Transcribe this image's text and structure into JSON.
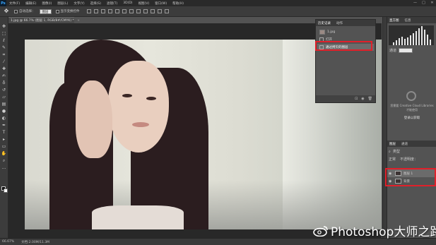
{
  "menubar": {
    "logo": "Ps",
    "items": [
      "文件(F)",
      "编辑(E)",
      "图像(I)",
      "图层(L)",
      "文字(Y)",
      "选择(S)",
      "滤镜(T)",
      "3D(D)",
      "视图(V)",
      "窗口(W)",
      "帮助(H)"
    ],
    "window_controls": [
      "—",
      "□",
      "✕"
    ]
  },
  "options": {
    "auto_select_label": "自动选择：",
    "auto_select_value": "图层",
    "show_transform_label": "显示变换控件"
  },
  "document": {
    "tab_title": "1.jpg @ 66.7% (图层 1, RGB/8#/CMYK) *",
    "close": "×"
  },
  "history_panel": {
    "tabs": [
      "历史记录",
      "动作"
    ],
    "snapshot_label": "1.jpg",
    "rows": [
      "打开",
      "通过拷贝的图层"
    ],
    "footer_icons": [
      "snapshot-icon",
      "camera-icon",
      "trash-icon"
    ]
  },
  "histogram_panel": {
    "tabs": [
      "直方图",
      "信息"
    ],
    "channel": "通道"
  },
  "library_panel": {
    "cc_text": "您需要 Creative Cloud Libraries 才能使用",
    "button": "登录以获取"
  },
  "layers_panel": {
    "tabs": [
      "图层",
      "通道"
    ],
    "filter_label": "类型",
    "blend_mode": "正常",
    "opacity_label": "不透明度：",
    "layers": [
      "图层 1",
      "背景"
    ]
  },
  "status": {
    "zoom": "66.67%",
    "doc_size": "文档:2.00M/11.3M"
  },
  "watermark": {
    "text": "Photoshop大师之路"
  },
  "colors": {
    "highlight": "#e0202a",
    "ps_blue": "#39a6ff"
  }
}
